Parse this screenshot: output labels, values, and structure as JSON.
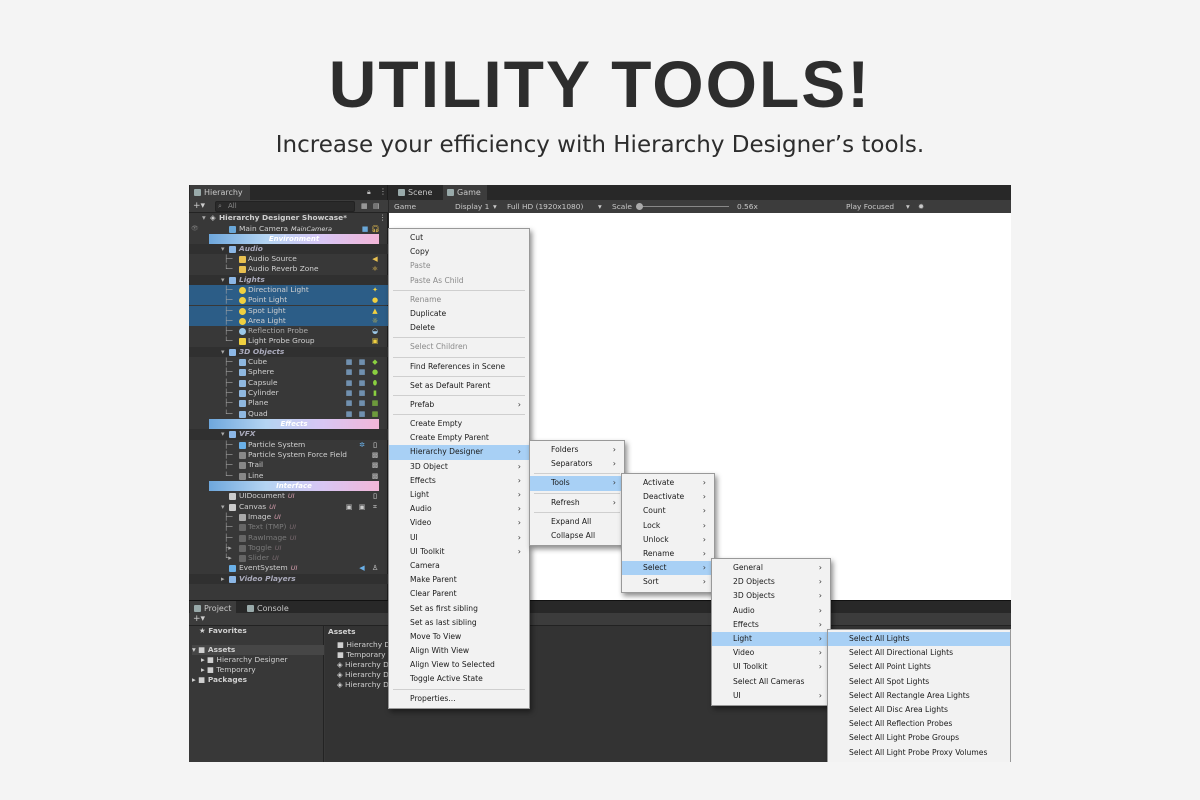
{
  "heading": {
    "title": "UTILITY TOOLS!",
    "subtitle": "Increase your efficiency with Hierarchy Designer’s tools."
  },
  "editor": {
    "hierarchy_tab": "Hierarchy",
    "search_placeholder": "All",
    "scene_tab": "Scene",
    "game_tab": "Game",
    "game_toolbar": {
      "display_mode": "Game",
      "display": "Display 1",
      "resolution": "Full HD (1920x1080)",
      "scale_label": "Scale",
      "scale_value": "0.56x",
      "play_mode": "Play Focused"
    },
    "scene_name": "Hierarchy Designer Showcase*",
    "main_camera": {
      "label": "Main Camera",
      "tag": "MainCamera"
    },
    "separators": {
      "environment": "Environment",
      "effects": "Effects",
      "interface": "Interface"
    },
    "folders": {
      "audio": "Audio",
      "lights": "Lights",
      "objects3d": "3D Objects",
      "vfx": "VFX",
      "video_players": "Video Players"
    },
    "rows": {
      "audio_source": "Audio Source",
      "audio_reverb": "Audio Reverb Zone",
      "directional_light": "Directional Light",
      "point_light": "Point Light",
      "spot_light": "Spot Light",
      "area_light": "Area Light",
      "reflection_probe": "Reflection Probe",
      "light_probe_group": "Light Probe Group",
      "cube": "Cube",
      "sphere": "Sphere",
      "capsule": "Capsule",
      "cylinder": "Cylinder",
      "plane": "Plane",
      "quad": "Quad",
      "particle_system": "Particle System",
      "particle_force": "Particle System Force Field",
      "trail": "Trail",
      "line": "Line",
      "ui_document": "UIDocument",
      "canvas": "Canvas",
      "image": "Image",
      "text_tmp": "Text (TMP)",
      "raw_image": "RawImage",
      "toggle": "Toggle",
      "slider": "Slider",
      "event_system": "EventSystem",
      "ui_tag": "UI"
    },
    "project": {
      "project_tab": "Project",
      "console_tab": "Console",
      "favorites": "Favorites",
      "assets": "Assets",
      "hierarchy_designer": "Hierarchy Designer",
      "temporary": "Temporary",
      "packages": "Packages",
      "assets_header": "Assets",
      "right_items": [
        "Hierarchy D",
        "Temporary",
        "Hierarchy D",
        "Hierarchy D",
        "Hierarchy D"
      ]
    }
  },
  "context_menu": {
    "items": [
      {
        "label": "Cut"
      },
      {
        "label": "Copy"
      },
      {
        "label": "Paste",
        "disabled": true
      },
      {
        "label": "Paste As Child",
        "disabled": true
      },
      {
        "sep": true
      },
      {
        "label": "Rename",
        "disabled": true
      },
      {
        "label": "Duplicate"
      },
      {
        "label": "Delete"
      },
      {
        "sep": true
      },
      {
        "label": "Select Children",
        "disabled": true
      },
      {
        "sep": true
      },
      {
        "label": "Find References in Scene"
      },
      {
        "sep": true
      },
      {
        "label": "Set as Default Parent"
      },
      {
        "sep": true
      },
      {
        "label": "Prefab",
        "sub": true
      },
      {
        "sep": true
      },
      {
        "label": "Create Empty"
      },
      {
        "label": "Create Empty Parent"
      },
      {
        "label": "Hierarchy Designer",
        "sub": true,
        "highlight": true
      },
      {
        "label": "3D Object",
        "sub": true
      },
      {
        "label": "Effects",
        "sub": true
      },
      {
        "label": "Light",
        "sub": true
      },
      {
        "label": "Audio",
        "sub": true
      },
      {
        "label": "Video",
        "sub": true
      },
      {
        "label": "UI",
        "sub": true
      },
      {
        "label": "UI Toolkit",
        "sub": true
      },
      {
        "label": "Camera"
      },
      {
        "label": "Make Parent"
      },
      {
        "label": "Clear Parent"
      },
      {
        "label": "Set as first sibling"
      },
      {
        "label": "Set as last sibling"
      },
      {
        "label": "Move To View"
      },
      {
        "label": "Align With View"
      },
      {
        "label": "Align View to Selected"
      },
      {
        "label": "Toggle Active State"
      },
      {
        "sep": true
      },
      {
        "label": "Properties..."
      }
    ]
  },
  "submenu_hd": {
    "items": [
      {
        "label": "Folders",
        "sub": true
      },
      {
        "label": "Separators",
        "sub": true
      },
      {
        "sep": true
      },
      {
        "label": "Tools",
        "sub": true,
        "highlight": true
      },
      {
        "sep": true
      },
      {
        "label": "Refresh",
        "sub": true
      },
      {
        "sep": true
      },
      {
        "label": "Expand All"
      },
      {
        "label": "Collapse All"
      }
    ]
  },
  "submenu_tools": {
    "items": [
      {
        "label": "Activate",
        "sub": true
      },
      {
        "label": "Deactivate",
        "sub": true
      },
      {
        "label": "Count",
        "sub": true
      },
      {
        "label": "Lock",
        "sub": true
      },
      {
        "label": "Unlock",
        "sub": true
      },
      {
        "label": "Rename",
        "sub": true
      },
      {
        "label": "Select",
        "sub": true,
        "highlight": true
      },
      {
        "label": "Sort",
        "sub": true
      }
    ]
  },
  "submenu_select": {
    "items": [
      {
        "label": "General",
        "sub": true
      },
      {
        "label": "2D Objects",
        "sub": true
      },
      {
        "label": "3D Objects",
        "sub": true
      },
      {
        "label": "Audio",
        "sub": true
      },
      {
        "label": "Effects",
        "sub": true
      },
      {
        "label": "Light",
        "sub": true,
        "highlight": true
      },
      {
        "label": "Video",
        "sub": true
      },
      {
        "label": "UI Toolkit",
        "sub": true
      },
      {
        "label": "Select All Cameras"
      },
      {
        "label": "UI",
        "sub": true
      }
    ]
  },
  "submenu_light": {
    "items": [
      {
        "label": "Select All Lights",
        "highlight": true
      },
      {
        "label": "Select All Directional Lights"
      },
      {
        "label": "Select All Point Lights"
      },
      {
        "label": "Select All Spot Lights"
      },
      {
        "label": "Select All Rectangle Area Lights"
      },
      {
        "label": "Select All Disc Area Lights"
      },
      {
        "label": "Select All Reflection Probes"
      },
      {
        "label": "Select All Light Probe Groups"
      },
      {
        "label": "Select All Light Probe Proxy Volumes"
      }
    ]
  },
  "colors": {
    "highlight": "#a8d0f5",
    "selection": "#2c5d87",
    "panel": "#383838"
  }
}
